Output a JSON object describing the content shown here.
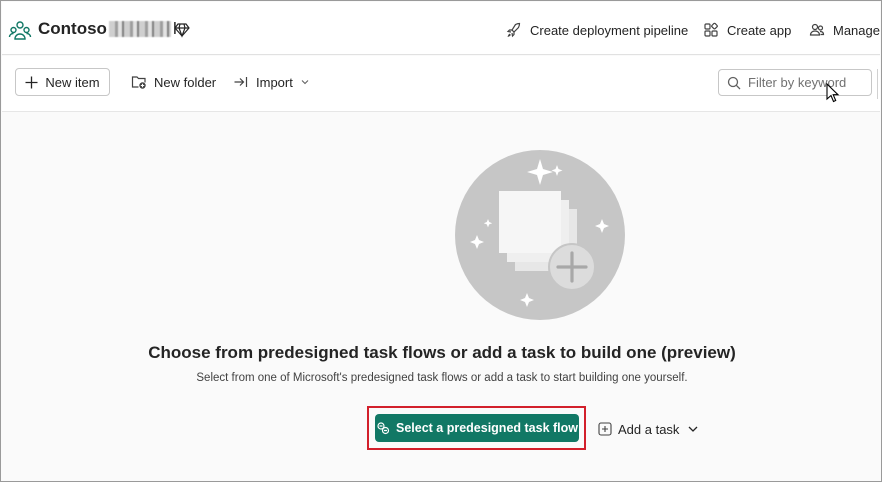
{
  "workspace": {
    "name": "Contoso",
    "icon": "workspace-people-icon",
    "badge_icon": "premium-diamond-icon"
  },
  "header_actions": {
    "deployment_pipeline": "Create deployment pipeline",
    "create_app": "Create app",
    "manage": "Manage"
  },
  "toolbar": {
    "new_item": "New item",
    "new_folder": "New folder",
    "import": "Import",
    "filter_placeholder": "Filter by keyword"
  },
  "empty_state": {
    "title": "Choose from predesigned task flows or add a task to build one (preview)",
    "description": "Select from one of Microsoft's predesigned task flows or add a task to start building one yourself.",
    "primary_button": "Select a predesigned task flow",
    "secondary_button": "Add a task"
  },
  "colors": {
    "primary": "#117865",
    "highlight": "#d21f2b"
  }
}
